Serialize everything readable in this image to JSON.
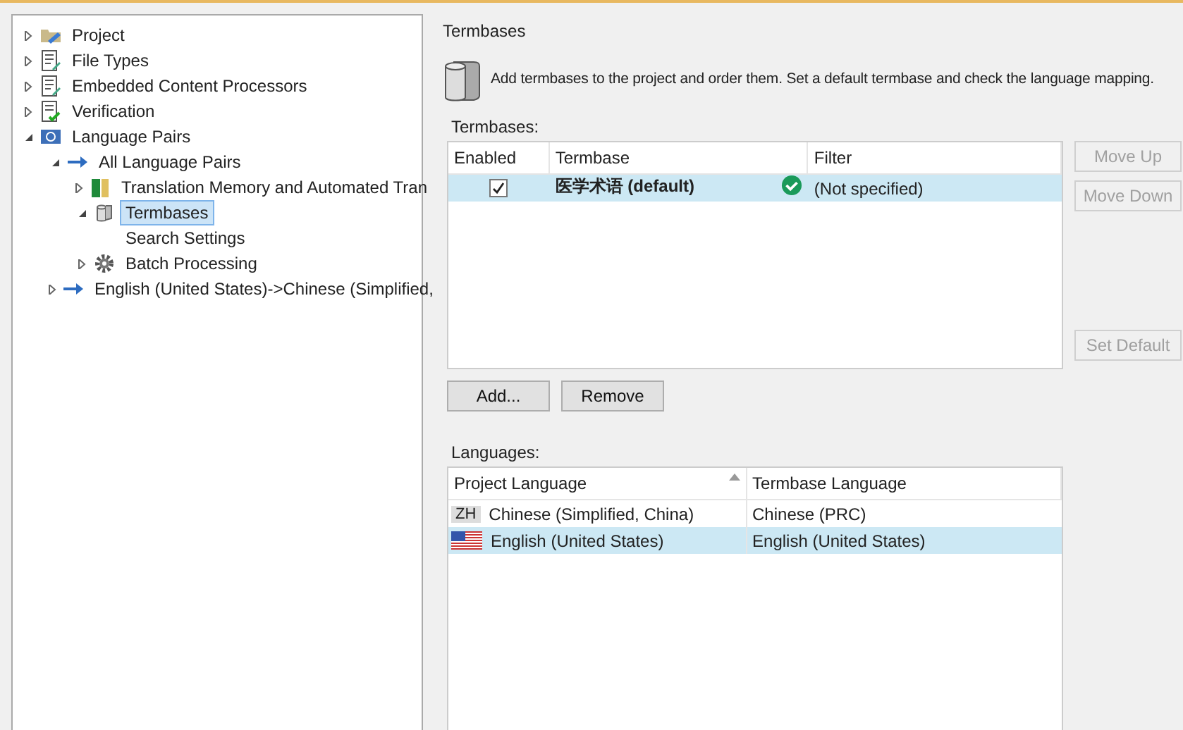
{
  "tree": [
    {
      "label": "Project",
      "kind": "project",
      "expanded": false,
      "selected": false
    },
    {
      "label": "File Types",
      "kind": "document",
      "expanded": false,
      "selected": false
    },
    {
      "label": "Embedded Content Processors",
      "kind": "document",
      "expanded": false,
      "selected": false
    },
    {
      "label": "Verification",
      "kind": "verify",
      "expanded": false,
      "selected": false
    },
    {
      "label": "Language Pairs",
      "kind": "pairs",
      "expanded": true,
      "selected": false,
      "children": [
        {
          "label": "All Language Pairs",
          "kind": "arrow",
          "expanded": true,
          "selected": false,
          "children": [
            {
              "label": "Translation Memory and Automated Tran",
              "kind": "tm",
              "expanded": false,
              "selected": false
            },
            {
              "label": "Termbases",
              "kind": "termbase",
              "expanded": true,
              "selected": true,
              "children": [
                {
                  "label": "Search Settings",
                  "selected": false
                }
              ]
            },
            {
              "label": "Batch Processing",
              "kind": "gear",
              "expanded": false,
              "selected": false
            }
          ]
        },
        {
          "label": "English (United States)->Chinese (Simplified,",
          "kind": "arrow",
          "expanded": false,
          "selected": false
        }
      ]
    }
  ],
  "panel": {
    "title": "Termbases",
    "description": "Add termbases to the project and order them. Set a default termbase and check the language mapping.",
    "termbases_label": "Termbases:",
    "termbases_table": {
      "columns": [
        "Enabled",
        "Termbase",
        "Filter"
      ],
      "rows": [
        {
          "enabled": true,
          "name": "医学术语 (default)",
          "status_ok": true,
          "filter": "(Not specified)",
          "selected": true
        }
      ]
    },
    "side_buttons": [
      {
        "label": "Move Up",
        "disabled": true
      },
      {
        "label": "Move Down",
        "disabled": true
      },
      {
        "label": "Set Default",
        "disabled": true
      }
    ],
    "buttons": [
      {
        "label": "Add...",
        "disabled": false
      },
      {
        "label": "Remove",
        "disabled": false
      }
    ],
    "languages_label": "Languages:",
    "languages_table": {
      "columns": [
        "Project Language",
        "Termbase Language"
      ],
      "rows": [
        {
          "kind": "code",
          "code": "ZH",
          "project": "Chinese (Simplified, China)",
          "termbase": "Chinese (PRC)",
          "selected": false
        },
        {
          "kind": "flag",
          "project": "English (United States)",
          "termbase": "English (United States)",
          "selected": true
        }
      ]
    }
  }
}
